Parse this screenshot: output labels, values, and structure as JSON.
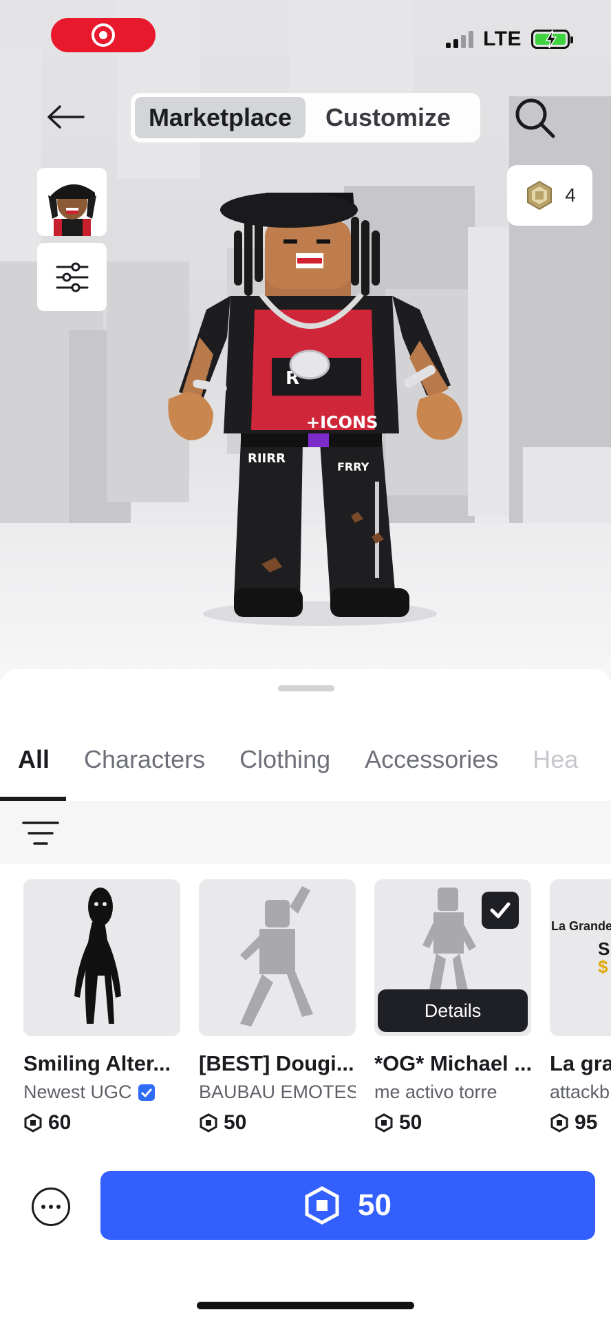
{
  "status_bar": {
    "network": "LTE",
    "signal_bars": 4,
    "signal_bars_active": 2,
    "battery_level": 1.0,
    "battery_charging": true,
    "battery_color": "#3ed23e",
    "pill_color": "#e8192c",
    "pill_icon": "target-icon"
  },
  "header": {
    "back_icon": "arrow-left-icon",
    "segments": [
      {
        "label": "Marketplace",
        "active": true
      },
      {
        "label": "Customize",
        "active": false
      }
    ],
    "search_icon": "search-icon",
    "robux_balance": "4",
    "robux_icon": "robux-icon",
    "filter_icon": "sliders-icon"
  },
  "sheet": {
    "categories": [
      {
        "label": "All",
        "active": true
      },
      {
        "label": "Characters",
        "active": false
      },
      {
        "label": "Clothing",
        "active": false
      },
      {
        "label": "Accessories",
        "active": false
      },
      {
        "label": "Hea",
        "active": false
      }
    ],
    "sort_icon": "sort-lines-icon",
    "items": [
      {
        "name": "Smiling Alter...",
        "creator": "Newest UGC",
        "verified": true,
        "price": "60",
        "selected": false
      },
      {
        "name": "[BEST] Dougi...",
        "creator": "BAUBAU EMOTES",
        "verified": false,
        "price": "50",
        "selected": false
      },
      {
        "name": "*OG* Michael ...",
        "creator": "me activo torre",
        "verified": false,
        "price": "50",
        "selected": true,
        "details_label": "Details"
      },
      {
        "name": "La gra",
        "creator": "attackb",
        "verified": false,
        "price": "95",
        "selected": false,
        "thumb_text_1": "La Grande",
        "thumb_text_2": "S",
        "thumb_text_3": "$"
      }
    ]
  },
  "footer": {
    "more_icon": "more-dots-icon",
    "buy_price": "50",
    "buy_color": "#335fff"
  }
}
